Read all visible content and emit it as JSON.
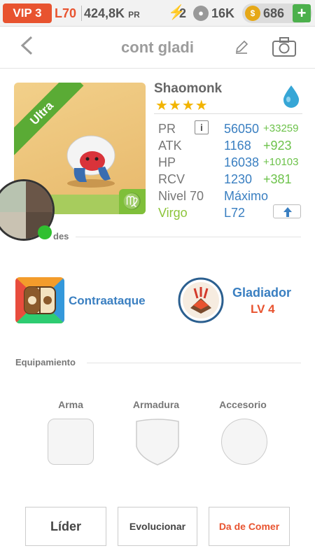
{
  "topbar": {
    "vip": "VIP 3",
    "level": "L70",
    "pr_value": "424,8K",
    "pr_unit": "PR",
    "energy": "2",
    "paws": "16K",
    "coins": "686",
    "plus": "+"
  },
  "header": {
    "title": "cont gladi"
  },
  "card": {
    "rarity": "Ultra",
    "zodiac_symbol": "♍"
  },
  "monster": {
    "name": "Shaomonk",
    "stars": "★★★★",
    "stats": [
      {
        "label": "PR",
        "value": "56050",
        "bonus": "+33259"
      },
      {
        "label": "ATK",
        "value": "1168",
        "bonus": "+923"
      },
      {
        "label": "HP",
        "value": "16038",
        "bonus": "+10103"
      },
      {
        "label": "RCV",
        "value": "1230",
        "bonus": "+381"
      },
      {
        "label": "Nivel 70",
        "value": "Máximo",
        "bonus": ""
      },
      {
        "label": "Virgo",
        "value": "L72",
        "bonus": ""
      }
    ],
    "info_glyph": "i"
  },
  "sections": {
    "abilities_partial": "des",
    "equipment": "Equipamiento"
  },
  "skills": {
    "skill_name": "Contraataque",
    "class_name": "Gladiador",
    "class_level": "LV 4"
  },
  "equipment": {
    "slots": [
      "Arma",
      "Armadura",
      "Accesorio"
    ]
  },
  "buttons": {
    "leader": "Líder",
    "evolve": "Evolucionar",
    "feed": "Da de Comer"
  },
  "colors": {
    "accent_orange": "#e8532f",
    "blue": "#3a7fc1",
    "green": "#6cc24a"
  }
}
